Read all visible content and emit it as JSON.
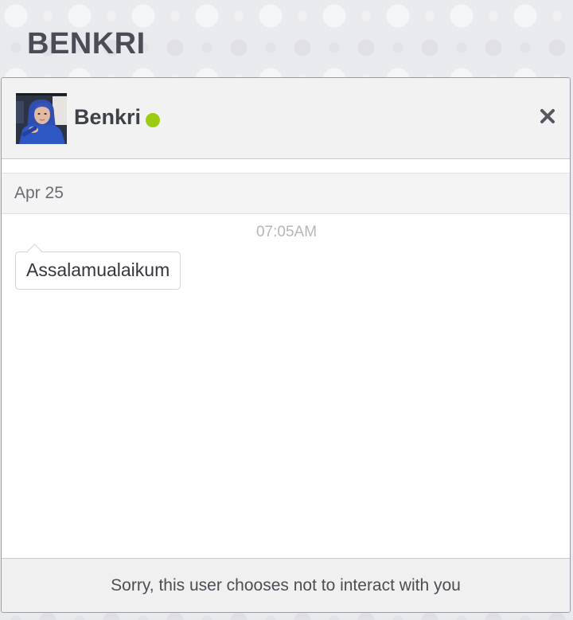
{
  "page": {
    "title": "BENKRI"
  },
  "chat": {
    "contact_name": "Benkri",
    "status": "online",
    "status_color": "#9ccc10",
    "close_icon": "close-icon",
    "date_label": "Apr 25",
    "messages": [
      {
        "time": "07:05AM",
        "text": "Assalamualaikum"
      }
    ],
    "footer_notice": "Sorry, this user chooses not to interact with you"
  }
}
